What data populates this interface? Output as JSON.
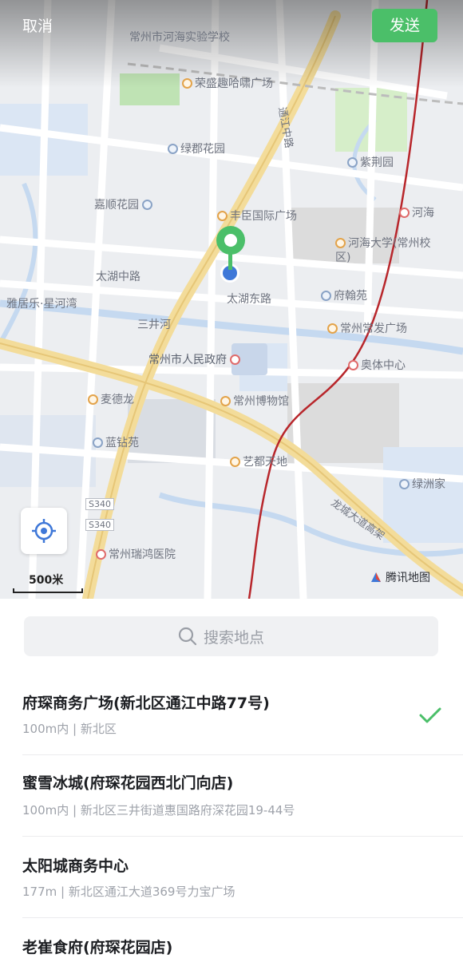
{
  "header": {
    "cancel_label": "取消",
    "send_label": "发送"
  },
  "map": {
    "labels": {
      "school": "常州市河海实验学校",
      "plaza_top": "荣盛趣哈啸广场",
      "lvjun": "绿郡花园",
      "zijing": "紫荆园",
      "jiashun": "嘉顺花园",
      "fengchen": "丰臣国际广场",
      "hehai": "河海",
      "hhu": "河海大学(常州校区)",
      "taihu_mid": "太湖中路",
      "taihu_east": "太湖东路",
      "fuhan": "府翰苑",
      "yaju": "雅居乐·星河湾",
      "sanjinghe": "三井河",
      "changfa": "常州常发广场",
      "gov": "常州市人民政府",
      "olympic": "奥体中心",
      "maidelong": "麦德龙",
      "museum": "常州博物馆",
      "lanzuan": "蓝钻苑",
      "yidu": "艺都天地",
      "lvzhou": "绿洲家",
      "s340a": "S340",
      "s340b": "S340",
      "ruihong": "常州瑞鸿医院",
      "longcheng": "龙城大道高架",
      "tongjiang": "通江中路"
    },
    "scale_label": "500米",
    "brand_label": "腾讯地图",
    "accent_color": "#4bbf69"
  },
  "search": {
    "placeholder": "搜索地点"
  },
  "results": [
    {
      "title": "府琛商务广场(新北区通江中路77号)",
      "subtitle": "100m内 | 新北区",
      "selected": true
    },
    {
      "title": "蜜雪冰城(府琛花园西北门向店)",
      "subtitle": "100m内 | 新北区三井街道惠国路府深花园19-44号",
      "selected": false
    },
    {
      "title": "太阳城商务中心",
      "subtitle": "177m | 新北区通江大道369号力宝广场",
      "selected": false
    },
    {
      "title": "老崔食府(府琛花园店)",
      "subtitle": "",
      "selected": false
    }
  ]
}
